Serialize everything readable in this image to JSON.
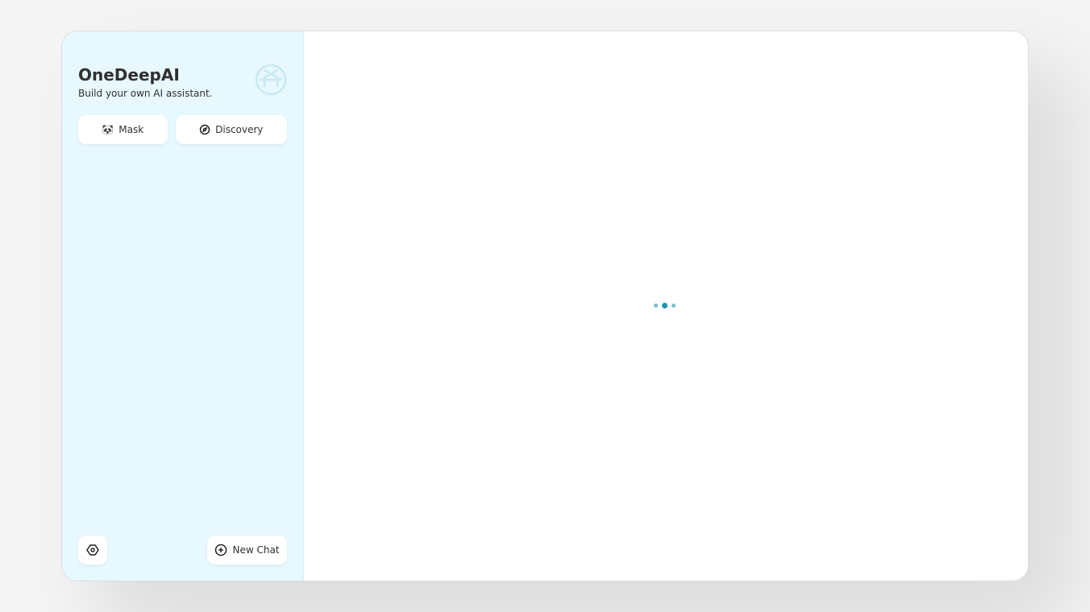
{
  "sidebar": {
    "title": "OneDeepAI",
    "subtitle": "Build your own AI assistant.",
    "mask_label": "Mask",
    "discovery_label": "Discovery",
    "new_chat_label": "New Chat"
  },
  "colors": {
    "accent": "#1d93ab",
    "sidebar_bg": "#e7f8ff"
  }
}
